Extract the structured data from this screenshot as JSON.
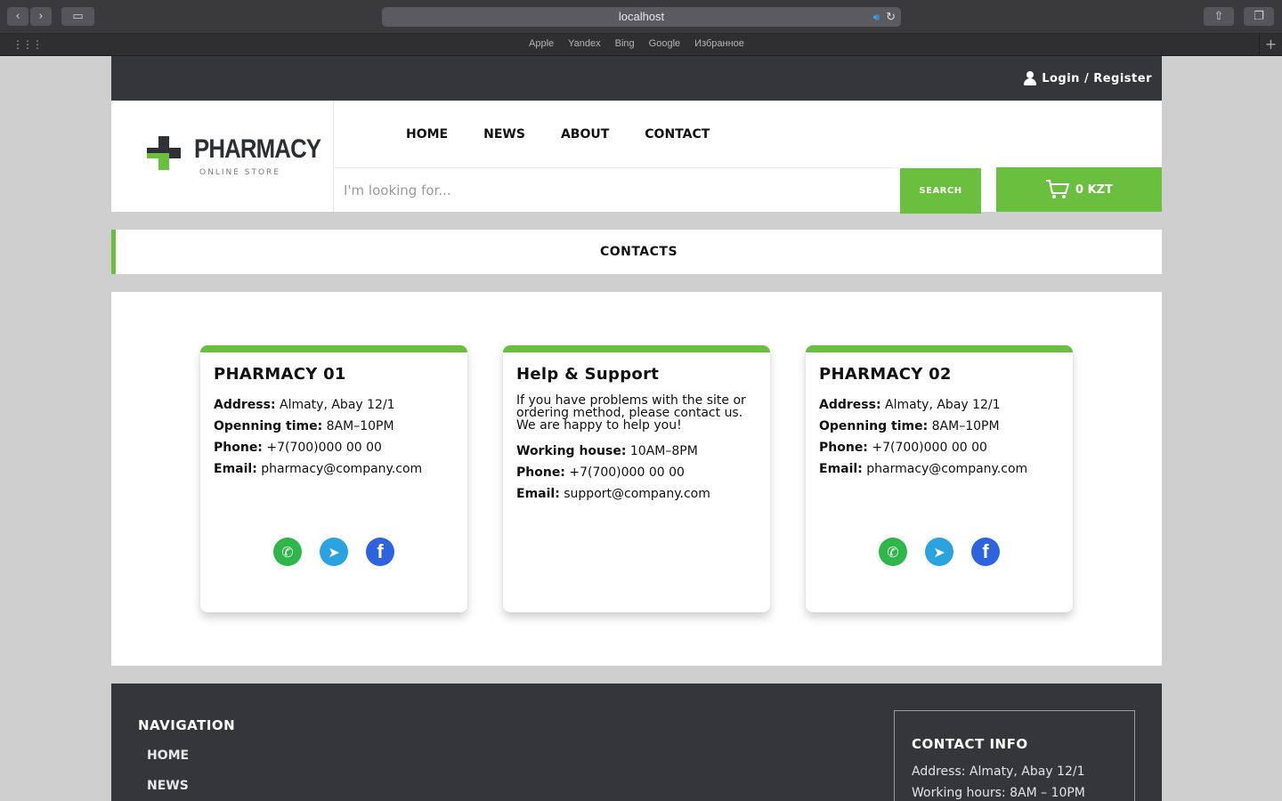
{
  "browser": {
    "url": "localhost",
    "favorites": [
      "Apple",
      "Yandex",
      "Bing",
      "Google",
      "Избранное"
    ]
  },
  "topbar": {
    "login_label": "Login / Register"
  },
  "logo": {
    "name": "PHARMACY",
    "subtitle": "ONLINE STORE"
  },
  "nav": {
    "items": [
      "HOME",
      "NEWS",
      "ABOUT",
      "CONTACT"
    ]
  },
  "search": {
    "placeholder": "I'm looking for...",
    "button_label": "SEARCH"
  },
  "cart": {
    "total": "0 KZT"
  },
  "page": {
    "title": "CONTACTS"
  },
  "cards": [
    {
      "title": "PHARMACY 01",
      "rows": [
        {
          "label": "Address:",
          "value": "Almaty, Abay 12/1"
        },
        {
          "label": "Openning time:",
          "value": "8AM–10PM"
        },
        {
          "label": "Phone:",
          "value": "+7(700)000 00 00"
        },
        {
          "label": "Email:",
          "value": "pharmacy@company.com"
        }
      ]
    },
    {
      "title": "Help & Support",
      "description": "If you have problems with the site or ordering method, please contact us. We are happy to help you!",
      "rows": [
        {
          "label": "Working house:",
          "value": "10AM–8PM"
        },
        {
          "label": "Phone:",
          "value": "+7(700)000 00 00"
        },
        {
          "label": "Email:",
          "value": "support@company.com"
        }
      ]
    },
    {
      "title": "PHARMACY 02",
      "rows": [
        {
          "label": "Address:",
          "value": "Almaty, Abay 12/1"
        },
        {
          "label": "Openning time:",
          "value": "8AM–10PM"
        },
        {
          "label": "Phone:",
          "value": "+7(700)000 00 00"
        },
        {
          "label": "Email:",
          "value": "pharmacy@company.com"
        }
      ]
    }
  ],
  "footer": {
    "nav_title": "NAVIGATION",
    "links": [
      "HOME",
      "NEWS"
    ],
    "contact_title": "CONTACT INFO",
    "contact_lines": [
      "Address: Almaty, Abay 12/1",
      "Working hours: 8AM – 10PM"
    ]
  },
  "colors": {
    "accent": "#6bbf3f",
    "dark": "#35363a",
    "background": "#cfcfcf"
  }
}
